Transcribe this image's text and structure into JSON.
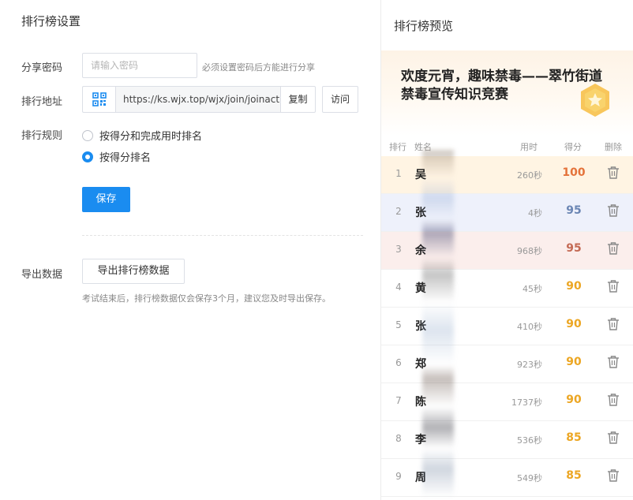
{
  "settings": {
    "title": "排行榜设置",
    "password": {
      "label": "分享密码",
      "placeholder": "请输入密码",
      "value": "",
      "hint": "必须设置密码后方能进行分享"
    },
    "address": {
      "label": "排行地址",
      "url": "https://ks.wjx.top/wjx/join/joinacti",
      "copy_label": "复制",
      "visit_label": "访问",
      "qr_icon": "qr-code-icon"
    },
    "rules": {
      "label": "排行规则",
      "options": [
        {
          "label": "按得分和完成用时排名",
          "checked": false
        },
        {
          "label": "按得分排名",
          "checked": true
        }
      ]
    },
    "save_label": "保存",
    "export": {
      "label": "导出数据",
      "button_label": "导出排行榜数据",
      "hint": "考试结束后，排行榜数据仅会保存3个月，建议您及时导出保存。"
    }
  },
  "preview": {
    "title": "排行榜预览",
    "banner": {
      "line1": "欢度元宵，趣味禁毒——翠竹街道",
      "line2": "禁毒宣传知识竞赛"
    },
    "columns": [
      "排行",
      "姓名",
      "用时",
      "得分",
      "删除"
    ],
    "rows": [
      {
        "rank": "1",
        "name": "吴",
        "time": "260秒",
        "score": "100",
        "score_color": "#e4723a",
        "bg": "#fff4e3"
      },
      {
        "rank": "2",
        "name": "张",
        "time": "4秒",
        "score": "95",
        "score_color": "#6b86b4",
        "bg": "#eef1fb"
      },
      {
        "rank": "3",
        "name": "余",
        "time": "968秒",
        "score": "95",
        "score_color": "#c46a54",
        "bg": "#fbeeec"
      },
      {
        "rank": "4",
        "name": "黄",
        "time": "45秒",
        "score": "90",
        "score_color": "#eca623",
        "bg": "#ffffff"
      },
      {
        "rank": "5",
        "name": "张",
        "time": "410秒",
        "score": "90",
        "score_color": "#eca623",
        "bg": "#ffffff"
      },
      {
        "rank": "6",
        "name": "郑",
        "time": "923秒",
        "score": "90",
        "score_color": "#eca623",
        "bg": "#ffffff"
      },
      {
        "rank": "7",
        "name": "陈",
        "time": "1737秒",
        "score": "90",
        "score_color": "#eca623",
        "bg": "#ffffff"
      },
      {
        "rank": "8",
        "name": "李",
        "time": "536秒",
        "score": "85",
        "score_color": "#eca623",
        "bg": "#ffffff"
      },
      {
        "rank": "9",
        "name": "周",
        "time": "549秒",
        "score": "85",
        "score_color": "#eca623",
        "bg": "#ffffff"
      }
    ],
    "delete_icon": "trash-icon"
  }
}
